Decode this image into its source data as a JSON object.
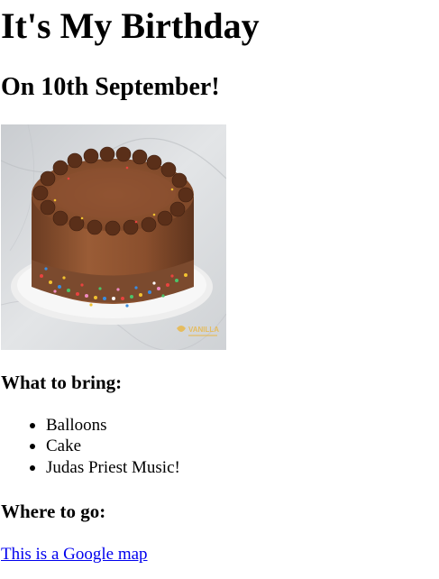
{
  "title": "It's My Birthday",
  "subtitle": "On 10th September!",
  "image": {
    "description_icon": "chocolate-cake-image",
    "watermark": "VANILLA"
  },
  "bring": {
    "heading": "What to bring:",
    "items": [
      "Balloons",
      "Cake",
      "Judas Priest Music!"
    ]
  },
  "where": {
    "heading": "Where to go:",
    "link_text": "This is a Google map"
  },
  "colors": {
    "link": "#0000ee",
    "text": "#000000",
    "background": "#ffffff"
  }
}
